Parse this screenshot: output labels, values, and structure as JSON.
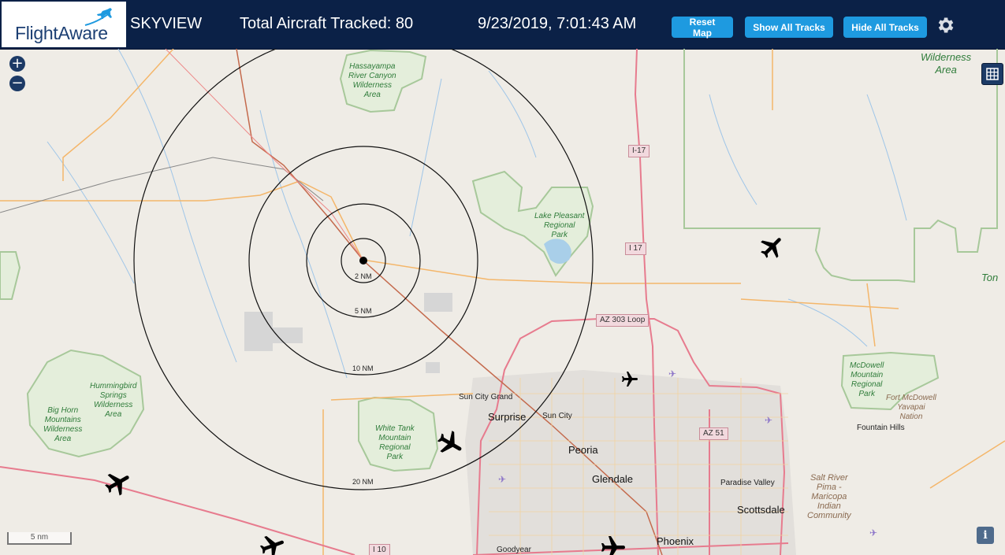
{
  "header": {
    "logo_text": "FlightAware",
    "app_title": "SKYVIEW",
    "aircraft_count_text": "Total Aircraft Tracked: 80",
    "datetime": "9/23/2019, 7:01:43 AM",
    "buttons": {
      "reset_map": "Reset Map",
      "show_all_tracks": "Show All Tracks",
      "hide_all_tracks": "Hide All Tracks"
    },
    "settings_icon": "gear-icon"
  },
  "map_controls": {
    "zoom_in": "+",
    "zoom_out": "−",
    "layers_icon": "grid-icon",
    "info_label": "i",
    "scale_label": "5 nm"
  },
  "range_rings": [
    "2 NM",
    "5 NM",
    "10 NM",
    "20 NM"
  ],
  "places": {
    "hassayampa": "Hassayampa\nRiver Canyon\nWilderness\nArea",
    "lake_pleasant": "Lake Pleasant\nRegional\nPark",
    "hummingbird": "Hummingbird\nSprings\nWilderness\nArea",
    "big_horn": "Big Horn\nMountains\nWilderness\nArea",
    "white_tank": "White Tank\nMountain\nRegional\nPark",
    "mcdowell": "McDowell\nMountain\nRegional\nPark",
    "fort_mcdowell": "Fort McDowell\nYavapai\nNation",
    "salt_river": "Salt River\nPima -\nMaricopa\nIndian\nCommunity",
    "wilderness_area": "Wilderness\nArea",
    "ton": "Ton",
    "sun_city_grand": "Sun City Grand",
    "surprise": "Surprise",
    "sun_city": "Sun City",
    "peoria": "Peoria",
    "glendale": "Glendale",
    "phoenix": "Phoenix",
    "scottsdale": "Scottsdale",
    "paradise_valley": "Paradise Valley",
    "fountain_hills": "Fountain Hills",
    "goodyear": "Goodyear"
  },
  "highways": {
    "i17_a": "I-17",
    "i17_b": "I 17",
    "az303": "AZ 303 Loop",
    "az51": "AZ 51",
    "i10": "I 10"
  },
  "colors": {
    "header_bg": "#0b2147",
    "button_bg": "#1e9ae0",
    "map_bg": "#efece6",
    "park_green": "#2f7c3a",
    "highway_pink": "#e77b8e"
  }
}
